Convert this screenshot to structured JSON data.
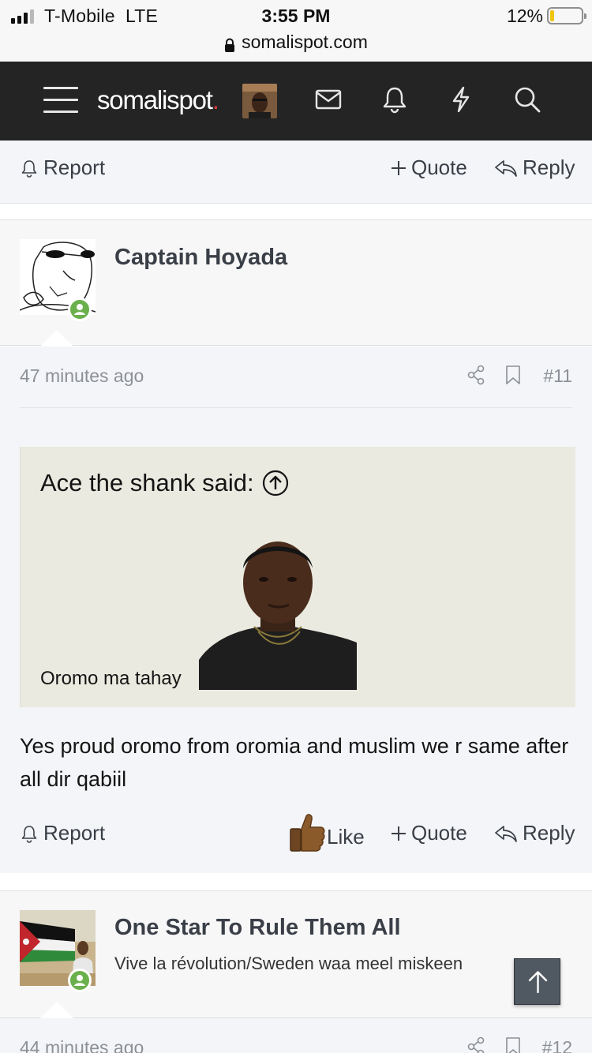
{
  "status_bar": {
    "carrier": "T-Mobile",
    "network": "LTE",
    "time": "3:55 PM",
    "battery_percent": "12%",
    "battery_level": 0.12,
    "url": "somalispot.com"
  },
  "header": {
    "logo_text": "somalispot",
    "logo_dot": ".",
    "icons": [
      "menu-icon",
      "avatar",
      "inbox-icon",
      "bell-icon",
      "lightning-icon",
      "search-icon"
    ]
  },
  "prev_post": {
    "report_label": "Report",
    "quote_label": "Quote",
    "reply_label": "Reply"
  },
  "post": {
    "username": "Captain Hoyada",
    "time": "47 minutes ago",
    "number": "#11",
    "quote_attribution": "Ace the shank said:",
    "quote_text": "Oromo ma tahay",
    "body": "Yes proud oromo from oromia and muslim we r same after all dir qabiil",
    "report_label": "Report",
    "like_label": "Like",
    "quote_label": "Quote",
    "reply_label": "Reply"
  },
  "next_post": {
    "username": "One Star To Rule Them All",
    "user_title": "Vive la révolution/Sweden waa meel miskeen",
    "time": "44 minutes ago",
    "number": "#12"
  },
  "colors": {
    "header_bg": "#242424",
    "logo_accent": "#d63c3c",
    "online": "#6ab04c",
    "quote_bg": "#ebeae0",
    "muted_text": "#8c9097"
  }
}
